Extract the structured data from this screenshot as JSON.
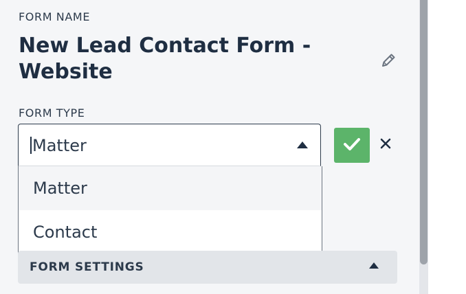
{
  "form": {
    "name_label": "FORM NAME",
    "name": "New Lead Contact Form - Website",
    "type_label": "FORM TYPE",
    "type_value": "Matter",
    "type_options": [
      "Matter",
      "Contact"
    ],
    "highlighted_option": "Matter"
  },
  "icons": {
    "edit": "pencil-icon",
    "confirm": "checkmark-icon",
    "cancel": "close-icon",
    "dropdown": "chevron-up-icon",
    "settings": "chevron-up-icon"
  },
  "settings": {
    "label": "FORM SETTINGS"
  },
  "colors": {
    "confirm_green": "#5cb46a",
    "text_dark": "#1f2e42",
    "panel_bg": "#f5f6f8",
    "settings_bg": "#e2e5e9"
  }
}
